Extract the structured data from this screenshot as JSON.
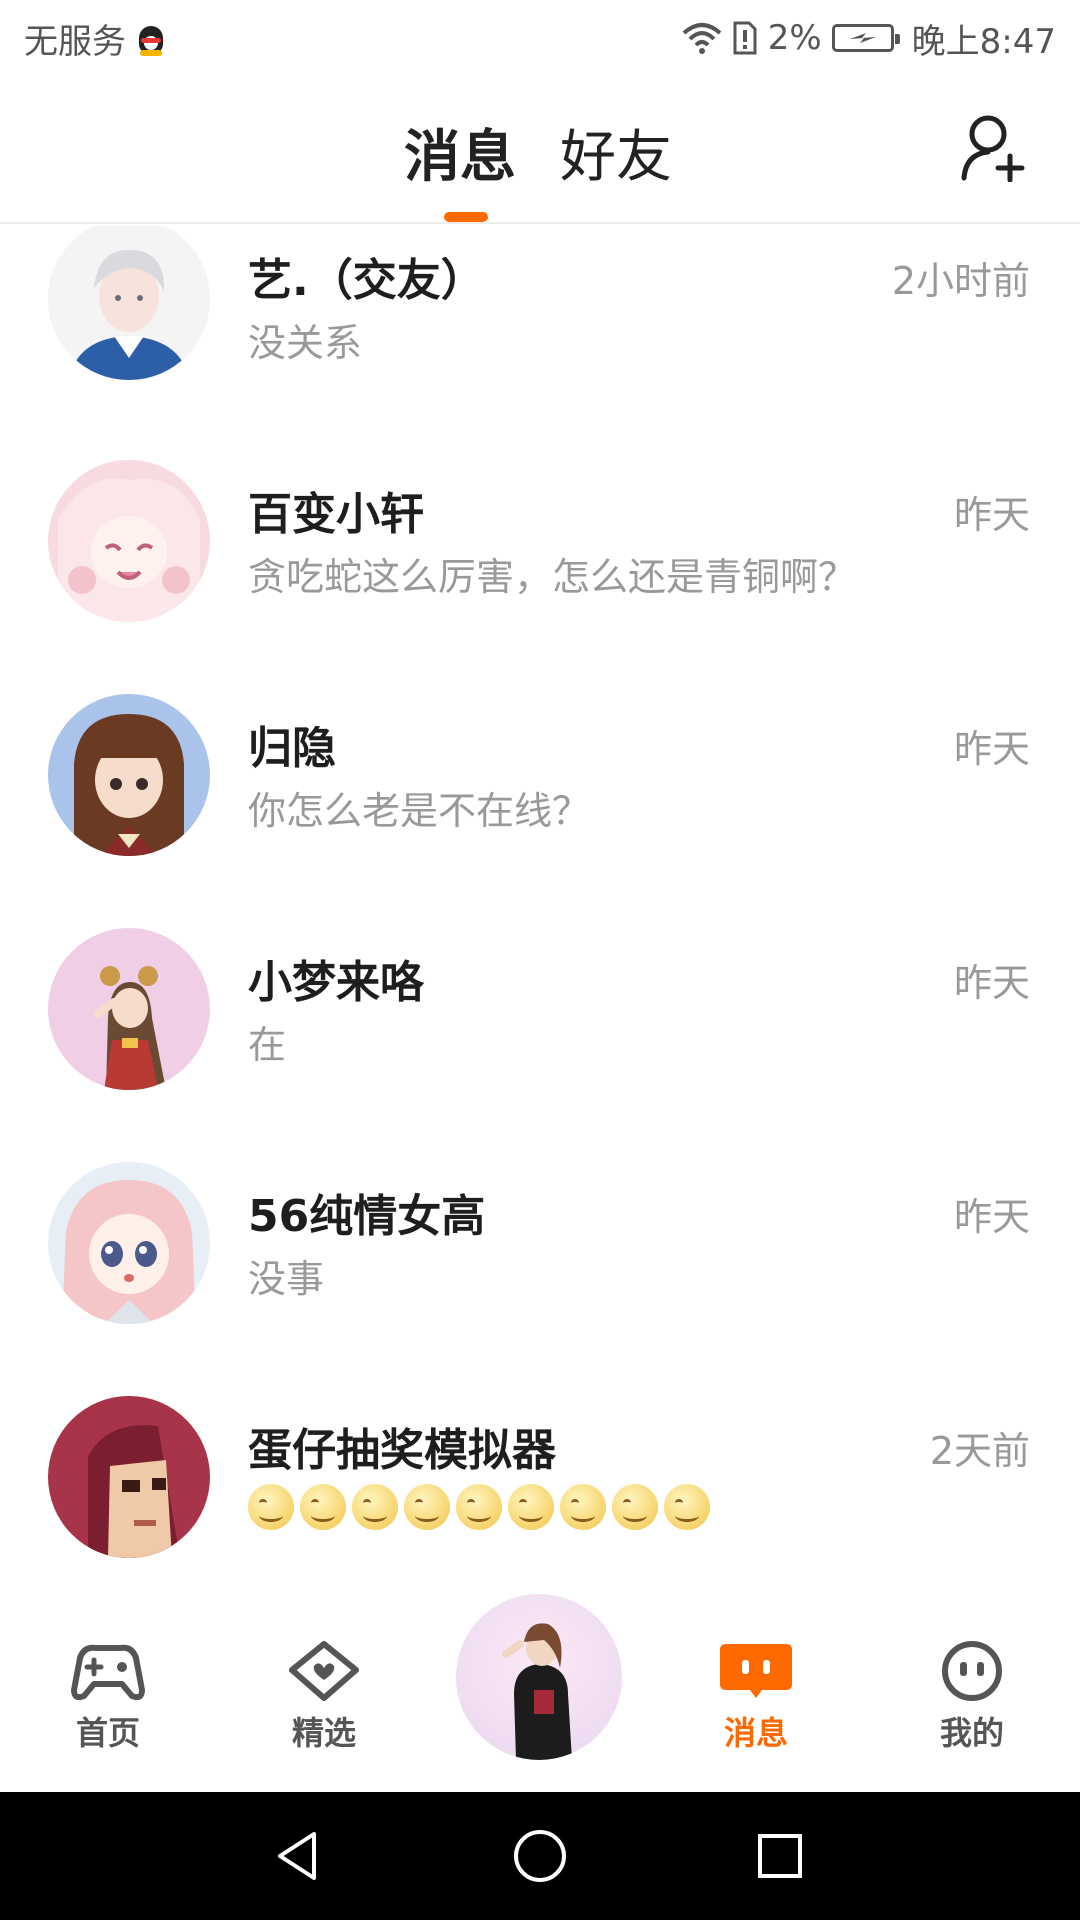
{
  "status_bar": {
    "carrier": "无服务",
    "battery_percent": "2%",
    "time": "晚上8:47"
  },
  "header": {
    "tabs": [
      {
        "label": "消息",
        "active": true
      },
      {
        "label": "好友",
        "active": false
      }
    ],
    "accent_color": "#ff6a00",
    "add_friend_icon": "add-friend-icon"
  },
  "conversations": [
    {
      "name": "艺.（交友）",
      "last_message": "没关系",
      "time": "2小时前"
    },
    {
      "name": "百变小轩",
      "last_message": "贪吃蛇这么厉害，怎么还是青铜啊？",
      "time": "昨天"
    },
    {
      "name": "归隐",
      "last_message": "你怎么老是不在线？",
      "time": "昨天"
    },
    {
      "name": "小梦来咯",
      "last_message": "在",
      "time": "昨天"
    },
    {
      "name": "56纯情女高",
      "last_message": "没事",
      "time": "昨天"
    },
    {
      "name": "蛋仔抽奖模拟器",
      "last_message": "",
      "emoji_count": 9,
      "time": "2天前"
    }
  ],
  "bottom_nav": [
    {
      "label": "首页",
      "icon": "gamepad-icon",
      "active": false
    },
    {
      "label": "精选",
      "icon": "heart-chat-icon",
      "active": false
    },
    {
      "label": "",
      "icon": "center-avatar",
      "active": false
    },
    {
      "label": "消息",
      "icon": "message-bubble-icon",
      "active": true
    },
    {
      "label": "我的",
      "icon": "face-icon",
      "active": false
    }
  ],
  "system_nav": [
    "back-icon",
    "home-icon",
    "recents-icon"
  ]
}
